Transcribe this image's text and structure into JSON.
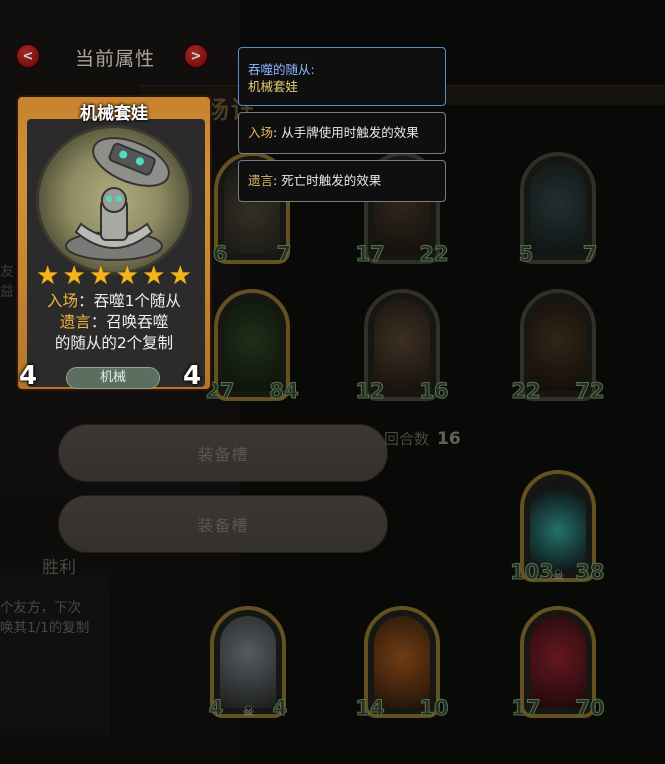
{
  "header": {
    "title": "当前属性",
    "prev_icon": "chevron-left-icon",
    "next_icon": "chevron-right-icon",
    "prev_glyph": "<",
    "next_glyph": ">"
  },
  "background": {
    "deco_text": "场详",
    "left_fragment": "友\n益",
    "victory_label": "胜利",
    "victory_desc": "个友方，下次\n唤其1/1的复制",
    "turns_label": "回合数",
    "turns_value": "16"
  },
  "equip_slots": [
    "装备槽",
    "装备槽"
  ],
  "tooltips": [
    {
      "title": "吞噬的随从:",
      "body": "机械套娃"
    },
    {
      "keyword": "入场",
      "text": ": 从手牌使用时触发的效果"
    },
    {
      "keyword": "遗言",
      "text": ": 死亡时触发的效果"
    }
  ],
  "card": {
    "name": "机械套娃",
    "stars": 6,
    "star_glyph": "★",
    "line1_kw": "入场",
    "line1_text": "：吞噬1个随从",
    "line2_kw": "遗言",
    "line2_text": "：召唤吞噬",
    "line3_text": "的随从的2个复制",
    "tribe": "机械",
    "attack": "4",
    "health": "4"
  },
  "board": [
    {
      "id": "wolf",
      "atk": "6",
      "hp": "7",
      "skull": false
    },
    {
      "id": "tree",
      "atk": "17",
      "hp": "22",
      "skull": false
    },
    {
      "id": "ghost",
      "atk": "5",
      "hp": "7",
      "skull": false
    },
    {
      "id": "moss",
      "atk": "27",
      "hp": "84",
      "skull": false
    },
    {
      "id": "golem",
      "atk": "12",
      "hp": "16",
      "skull": false
    },
    {
      "id": "ent",
      "atk": "22",
      "hp": "72",
      "skull": false
    },
    {
      "id": "slime",
      "atk": "103",
      "hp": "38",
      "skull": true
    },
    {
      "id": "doll",
      "atk": "4",
      "hp": "4",
      "skull": true
    },
    {
      "id": "pumpkin",
      "atk": "14",
      "hp": "10",
      "skull": false
    },
    {
      "id": "jester",
      "atk": "17",
      "hp": "70",
      "skull": false
    }
  ],
  "skull_glyph": "☠",
  "colors": {
    "accent_red": "#8e1414",
    "card_gold": "#c7832e",
    "keyword": "#f0b540",
    "tooltip_highlight": "#5c8bd2"
  }
}
